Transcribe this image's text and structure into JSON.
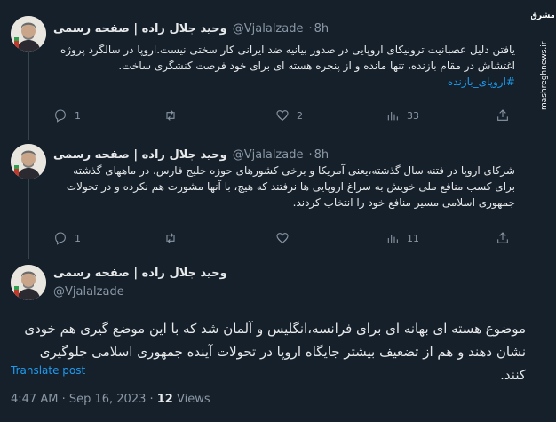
{
  "watermark": {
    "logo": "مشرق",
    "site": "mashreghnews.ir"
  },
  "tweets": [
    {
      "name": "وحید جلال زاده | صفحه رسمی",
      "handle": "@Vjalalzade",
      "time": "8h",
      "text": "یافتن دلیل عصبانیت ترونیکای اروپایی در صدور بیانیه ضد ایرانی کار سختی نیست.اروپا در سالگرد پروژه اغتشاش در مقام بازنده، تنها مانده و از پنجره هسته ای برای خود فرصت کنشگری ساخت.",
      "hashtag": "#اروپای_بازنده",
      "replies": "1",
      "retweets": "",
      "likes": "2",
      "views": "33"
    },
    {
      "name": "وحید جلال زاده | صفحه رسمی",
      "handle": "@Vjalalzade",
      "time": "8h",
      "text": "شرکای اروپا در فتنه سال گذشته،یعنی آمریکا و برخی کشورهای حوزه خلیج فارس، در ماههای گذشته برای کسب منافع ملی خویش به سراغ اروپایی ها نرفتند که هیچ، با آنها مشورت هم نکرده و در تحولات جمهوری اسلامی مسیر منافع خود را انتخاب کردند.",
      "replies": "1",
      "retweets": "",
      "likes": "",
      "views": "11"
    }
  ],
  "main": {
    "name": "وحید جلال زاده | صفحه رسمی",
    "handle": "@Vjalalzade",
    "text": "موضوع هسته ای بهانه ای برای فرانسه،انگلیس و آلمان شد که با این موضع گیری هم خودی نشان دهند و هم از تضعیف بیشتر جایگاه اروپا در تحولات آینده جمهوری اسلامی جلوگیری کنند.",
    "translate": "Translate post",
    "time": "4:47 AM · Sep 16, 2023 · ",
    "views_count": "12",
    "views_label": " Views"
  }
}
